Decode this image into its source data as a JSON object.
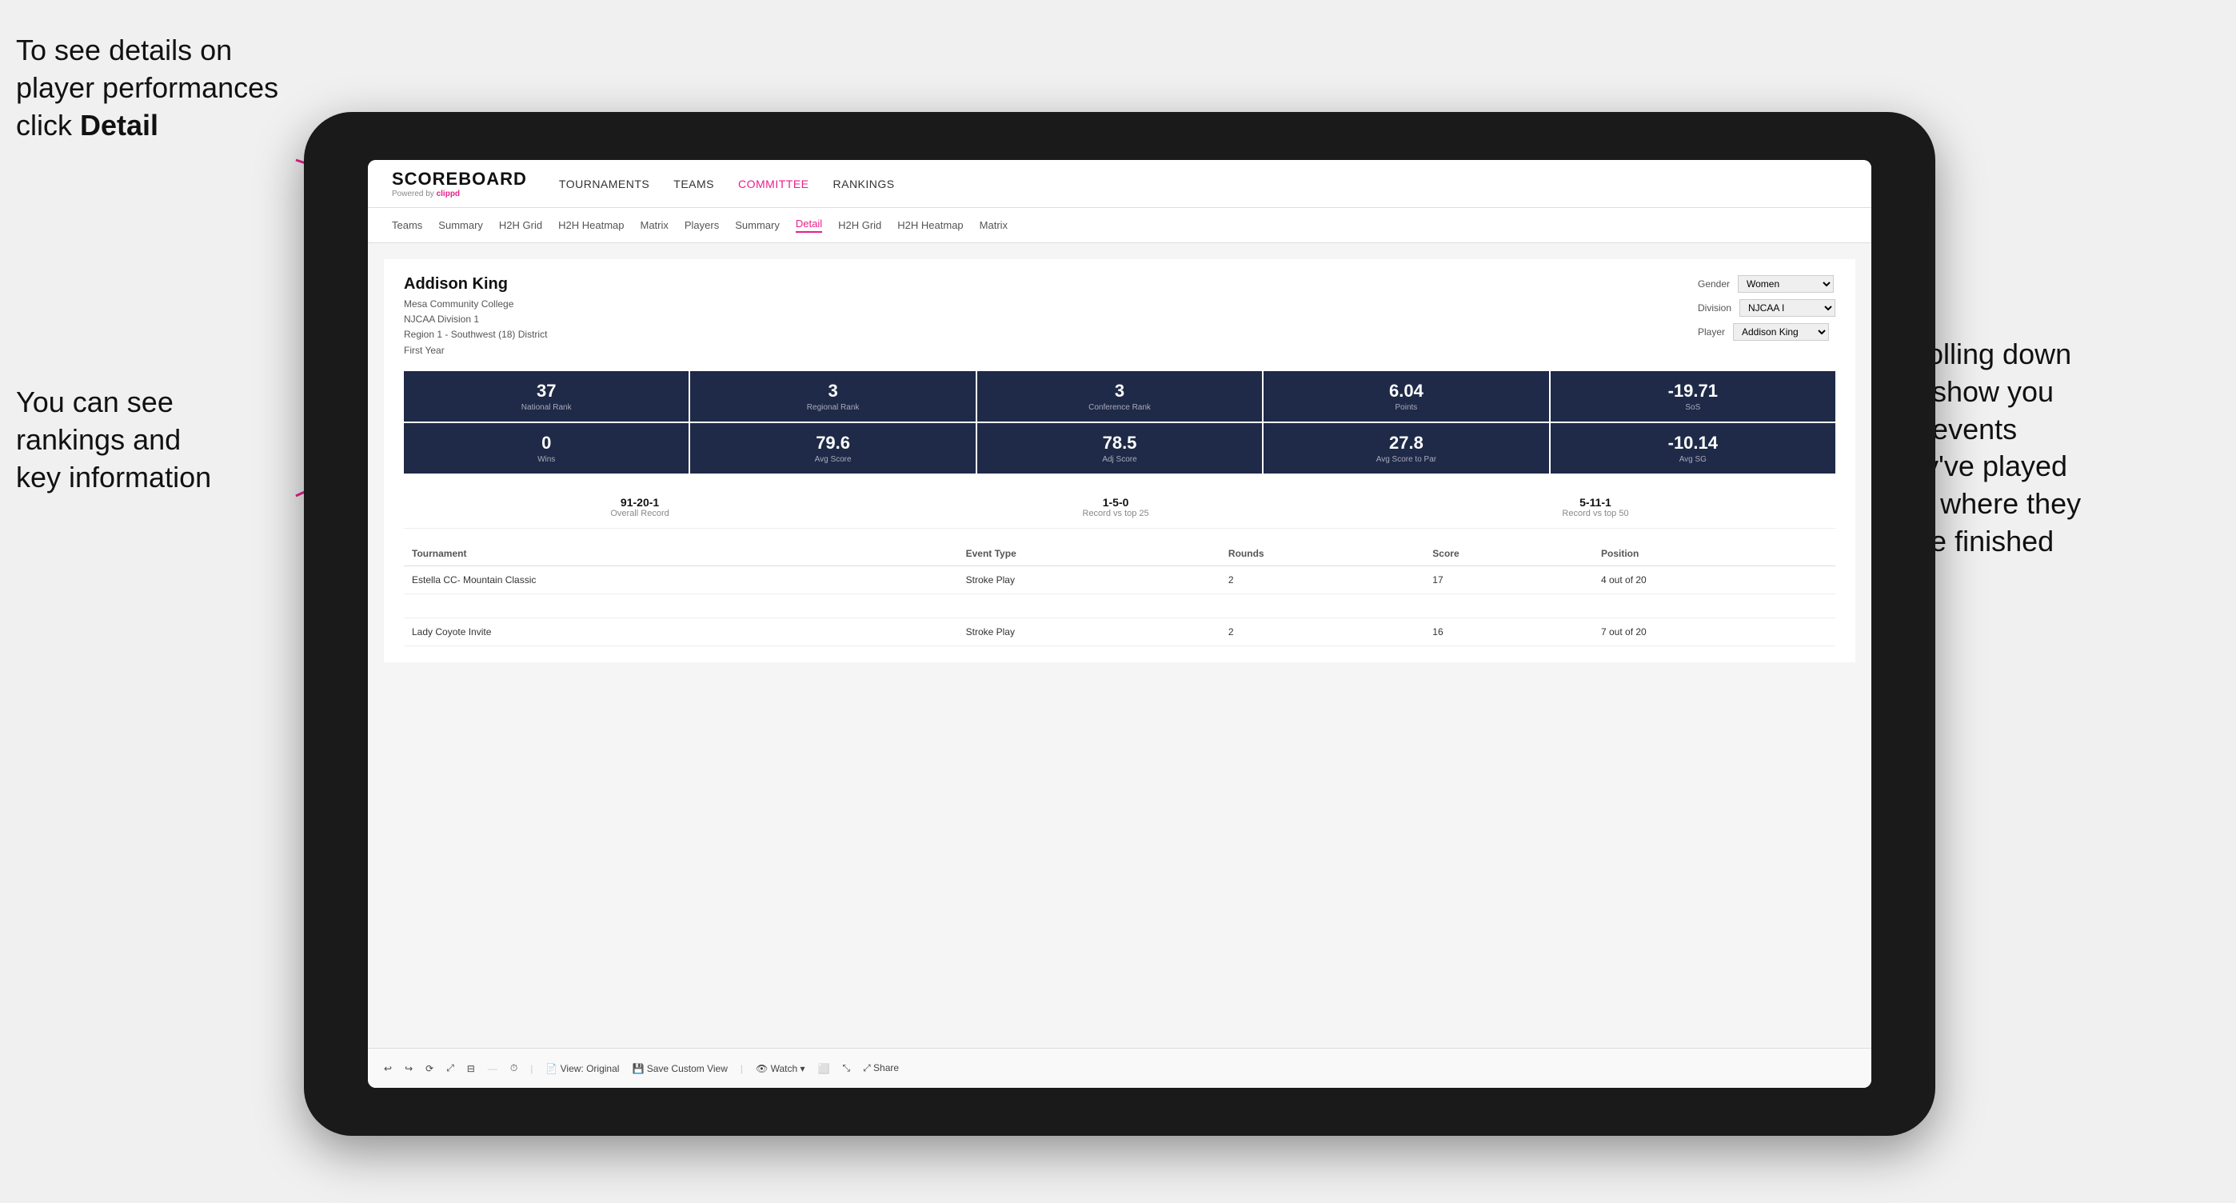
{
  "annotations": {
    "topLeft": {
      "line1": "To see details on",
      "line2": "player performances",
      "line3": "click ",
      "line3bold": "Detail"
    },
    "bottomLeft": {
      "line1": "You can see",
      "line2": "rankings and",
      "line3": "key information"
    },
    "right": {
      "line1": "Scrolling down",
      "line2": "will show you",
      "line3": "the events",
      "line4": "they've played",
      "line5": "and where they",
      "line6": "have finished"
    }
  },
  "app": {
    "logo": "SCOREBOARD",
    "powered_by": "Powered by clippd",
    "nav": {
      "items": [
        {
          "label": "TOURNAMENTS",
          "active": false
        },
        {
          "label": "TEAMS",
          "active": false
        },
        {
          "label": "COMMITTEE",
          "active": true
        },
        {
          "label": "RANKINGS",
          "active": false
        }
      ]
    },
    "sub_nav": {
      "items": [
        {
          "label": "Teams",
          "active": false
        },
        {
          "label": "Summary",
          "active": false
        },
        {
          "label": "H2H Grid",
          "active": false
        },
        {
          "label": "H2H Heatmap",
          "active": false
        },
        {
          "label": "Matrix",
          "active": false
        },
        {
          "label": "Players",
          "active": false
        },
        {
          "label": "Summary",
          "active": false
        },
        {
          "label": "Detail",
          "active": true
        },
        {
          "label": "H2H Grid",
          "active": false
        },
        {
          "label": "H2H Heatmap",
          "active": false
        },
        {
          "label": "Matrix",
          "active": false
        }
      ]
    }
  },
  "player": {
    "name": "Addison King",
    "college": "Mesa Community College",
    "division": "NJCAA Division 1",
    "region": "Region 1 - Southwest (18) District",
    "year": "First Year",
    "filters": {
      "gender_label": "Gender",
      "gender_value": "Women",
      "division_label": "Division",
      "division_value": "NJCAA I",
      "player_label": "Player",
      "player_value": "Addison King"
    }
  },
  "stats_row1": [
    {
      "value": "37",
      "label": "National Rank"
    },
    {
      "value": "3",
      "label": "Regional Rank"
    },
    {
      "value": "3",
      "label": "Conference Rank"
    },
    {
      "value": "6.04",
      "label": "Points"
    },
    {
      "value": "-19.71",
      "label": "SoS"
    }
  ],
  "stats_row2": [
    {
      "value": "0",
      "label": "Wins"
    },
    {
      "value": "79.6",
      "label": "Avg Score"
    },
    {
      "value": "78.5",
      "label": "Adj Score"
    },
    {
      "value": "27.8",
      "label": "Avg Score to Par"
    },
    {
      "value": "-10.14",
      "label": "Avg SG"
    }
  ],
  "records": [
    {
      "value": "91-20-1",
      "label": "Overall Record"
    },
    {
      "value": "1-5-0",
      "label": "Record vs top 25"
    },
    {
      "value": "5-11-1",
      "label": "Record vs top 50"
    }
  ],
  "table": {
    "columns": [
      "Tournament",
      "Event Type",
      "Rounds",
      "Score",
      "Position"
    ],
    "rows": [
      {
        "tournament": "Estella CC- Mountain Classic",
        "event_type": "Stroke Play",
        "rounds": "2",
        "score": "17",
        "position": "4 out of 20"
      },
      {
        "tournament": "",
        "event_type": "",
        "rounds": "",
        "score": "",
        "position": ""
      },
      {
        "tournament": "Lady Coyote Invite",
        "event_type": "Stroke Play",
        "rounds": "2",
        "score": "16",
        "position": "7 out of 20"
      }
    ]
  },
  "toolbar": {
    "buttons": [
      {
        "label": "↩",
        "name": "undo"
      },
      {
        "label": "↪",
        "name": "redo"
      },
      {
        "label": "⟳",
        "name": "refresh"
      },
      {
        "label": "⤢",
        "name": "expand"
      },
      {
        "label": "⊟",
        "name": "collapse"
      },
      {
        "label": "⏱",
        "name": "timer"
      },
      {
        "label": "View: Original",
        "name": "view-original"
      },
      {
        "label": "Save Custom View",
        "name": "save-view"
      },
      {
        "label": "👁 Watch ▾",
        "name": "watch"
      },
      {
        "label": "⬜",
        "name": "screen"
      },
      {
        "label": "⤡",
        "name": "fullscreen"
      },
      {
        "label": "⤢ Share",
        "name": "share"
      }
    ]
  }
}
